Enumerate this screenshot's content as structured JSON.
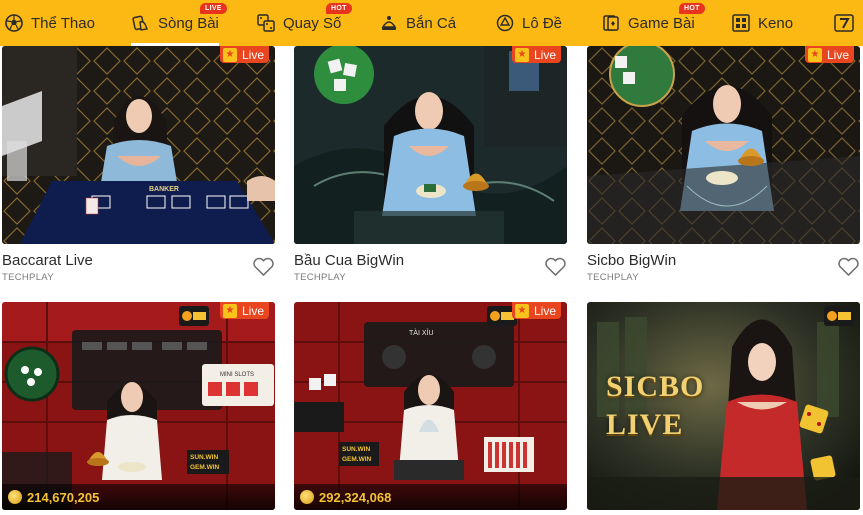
{
  "nav": {
    "items": [
      {
        "label": "Thể Thao",
        "icon": "soccer-ball-icon",
        "badge": ""
      },
      {
        "label": "Sòng Bài",
        "icon": "card-hand-icon",
        "badge": "LIVE"
      },
      {
        "label": "Quay Số",
        "icon": "dice-icon",
        "badge": "HOT"
      },
      {
        "label": "Bắn Cá",
        "icon": "fish-shooter-icon",
        "badge": ""
      },
      {
        "label": "Lô Đề",
        "icon": "lottery-ball-icon",
        "badge": ""
      },
      {
        "label": "Game Bài",
        "icon": "playing-card-icon",
        "badge": "HOT"
      },
      {
        "label": "Keno",
        "icon": "keno-grid-icon",
        "badge": ""
      },
      {
        "label": "",
        "icon": "slot-seven-icon",
        "badge": ""
      }
    ],
    "active": "Sòng Bài"
  },
  "cards": [
    {
      "title": "Baccarat Live",
      "provider": "TECHPLAY",
      "live_label": "Live",
      "jackpot": ""
    },
    {
      "title": "Bầu Cua BigWin",
      "provider": "TECHPLAY",
      "live_label": "Live",
      "jackpot": ""
    },
    {
      "title": "Sicbo BigWin",
      "provider": "TECHPLAY",
      "live_label": "Live",
      "jackpot": ""
    },
    {
      "title": "",
      "provider": "",
      "live_label": "Live",
      "jackpot": "214,670,205"
    },
    {
      "title": "",
      "provider": "",
      "live_label": "Live",
      "jackpot": "292,324,068"
    },
    {
      "title": "",
      "provider": "",
      "live_label": "",
      "jackpot": "",
      "banner_lines": [
        "SICBO",
        "LIVE"
      ]
    }
  ],
  "scene_text": {
    "banker": "BANKER",
    "mini_slots": "MINI SLOTS",
    "sun_win": "SUN.WIN",
    "gem_win": "GEM.WIN",
    "tai_xiu": "TÀI XỈU"
  },
  "colors": {
    "nav_bg": "#fdb913",
    "live_badge": "#e9451f",
    "jackpot_text": "#f4c233"
  }
}
